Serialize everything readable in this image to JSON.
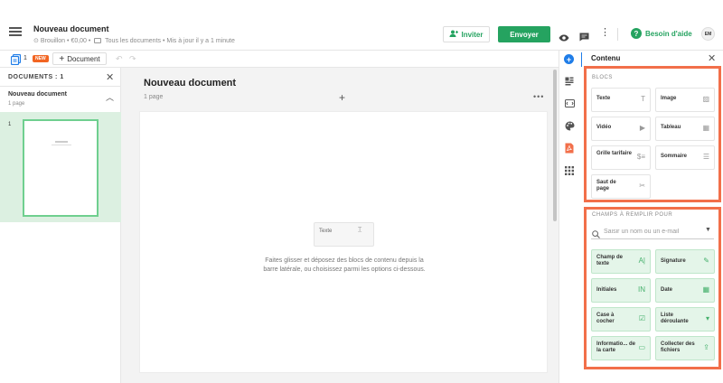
{
  "header": {
    "title": "Nouveau document",
    "status": "Brouillon",
    "price": "€0,00",
    "folder": "Tous les documents",
    "updated": "Mis à jour il y a 1 minute",
    "invite_label": "Inviter",
    "send_label": "Envoyer",
    "help_label": "Besoin d'aide",
    "avatar_initials": "EM"
  },
  "toolbar": {
    "doc_count": "1",
    "new_badge": "NEW",
    "add_document_label": "Document"
  },
  "documents_panel": {
    "title": "DOCUMENTS : 1",
    "item_name": "Nouveau document",
    "item_pages": "1 page",
    "thumb_number": "1"
  },
  "canvas": {
    "title": "Nouveau document",
    "pages": "1 page",
    "text_block_label": "Texte",
    "drop_hint": "Faites glisser et déposez des blocs de contenu depuis la barre latérale, ou choisissez parmi les options ci-dessous."
  },
  "content_panel": {
    "title": "Contenu",
    "blocks_label": "BLOCS",
    "blocks": [
      {
        "label": "Texte",
        "icon": "T"
      },
      {
        "label": "Image",
        "icon": "▨"
      },
      {
        "label": "Vidéo",
        "icon": "▶"
      },
      {
        "label": "Tableau",
        "icon": "▦"
      },
      {
        "label": "Grille tarifaire",
        "icon": "$≡"
      },
      {
        "label": "Sommaire",
        "icon": "☰"
      },
      {
        "label": "Saut de page",
        "icon": "✂"
      }
    ],
    "fields_label": "CHAMPS À REMPLIR POUR",
    "search_placeholder": "Saisir un nom ou un e-mail",
    "fields": [
      {
        "label": "Champ de texte",
        "icon": "A|"
      },
      {
        "label": "Signature",
        "icon": "✎"
      },
      {
        "label": "Initiales",
        "icon": "IN"
      },
      {
        "label": "Date",
        "icon": "▦"
      },
      {
        "label": "Case à cocher",
        "icon": "☑"
      },
      {
        "label": "Liste déroulante",
        "icon": "▾"
      },
      {
        "label": "Informatio... de la carte",
        "icon": "▭"
      },
      {
        "label": "Collecter des fichiers",
        "icon": "⇪"
      }
    ]
  },
  "colors": {
    "brand_green": "#25a360",
    "accent_blue": "#1f7de8",
    "highlight_orange": "#f26f4a"
  }
}
